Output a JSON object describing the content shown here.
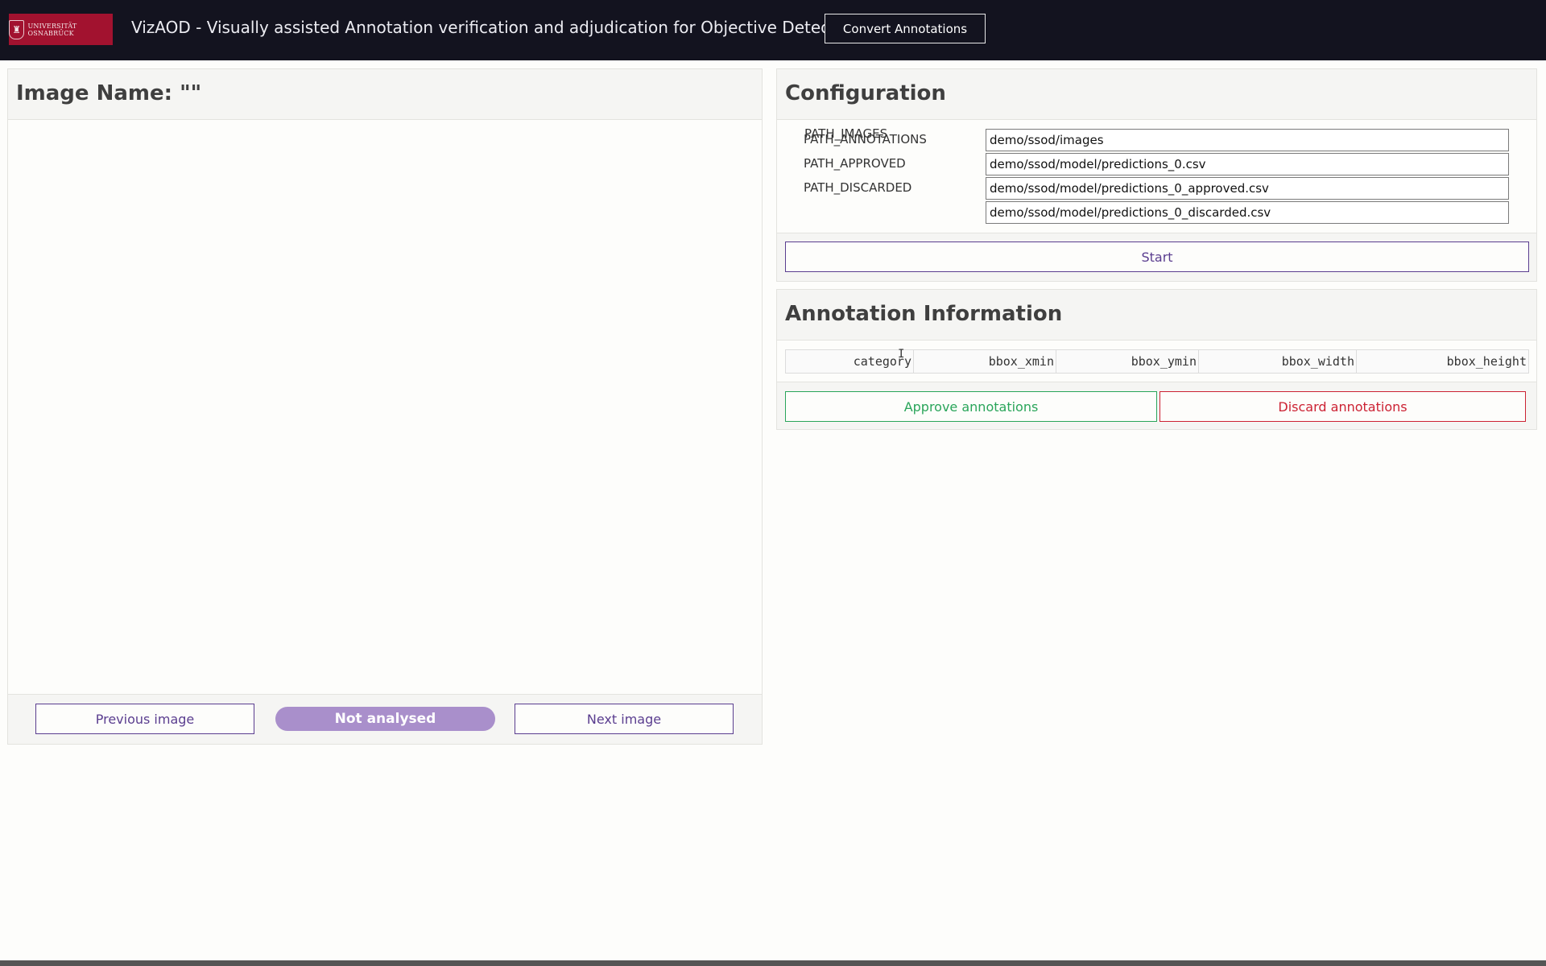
{
  "header": {
    "logo_text": "UNIVERSITÄT OSNABRÜCK",
    "title": "VizAOD - Visually assisted Annotation verification and adjudication for Objective Detection",
    "convert_label": "Convert Annotations"
  },
  "image_panel": {
    "title": "Image Name: \"\"",
    "prev_label": "Previous image",
    "status": "Not analysed",
    "next_label": "Next image"
  },
  "config": {
    "title": "Configuration",
    "rows": [
      {
        "label": "PATH_IMAGES",
        "value": "demo/ssod/images"
      },
      {
        "label": "PATH_ANNOTATIONS",
        "value": "demo/ssod/model/predictions_0.csv"
      },
      {
        "label": "PATH_APPROVED",
        "value": "demo/ssod/model/predictions_0_approved.csv"
      },
      {
        "label": "PATH_DISCARDED",
        "value": "demo/ssod/model/predictions_0_discarded.csv"
      }
    ],
    "start_label": "Start"
  },
  "annotation_info": {
    "title": "Annotation Information",
    "columns": [
      "category",
      "bbox_xmin",
      "bbox_ymin",
      "bbox_width",
      "bbox_height"
    ],
    "approve_label": "Approve annotations",
    "discard_label": "Discard annotations"
  },
  "colors": {
    "topbar": "#13131f",
    "brand": "#a2122f",
    "accent": "#5a3d8f",
    "status_pill": "#a98fcb",
    "approve": "#2aa55a",
    "discard": "#cc2233"
  }
}
